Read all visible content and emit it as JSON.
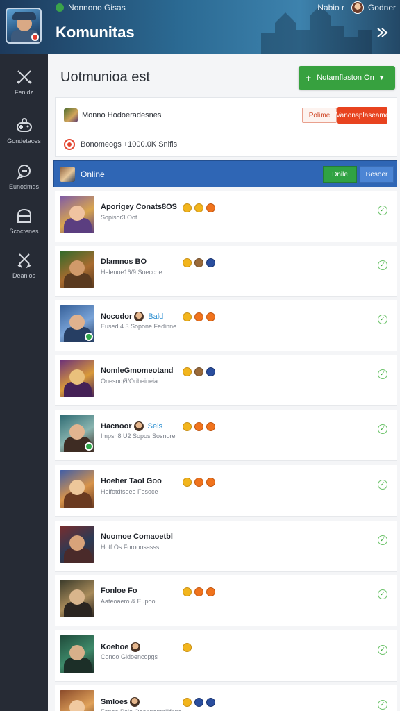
{
  "status_bar": {
    "app_name": "Nonnono Gisas",
    "right_text_1": "Nabio r",
    "right_text_2": "Godner"
  },
  "header": {
    "title": "Komunitas"
  },
  "sidebar": {
    "items": [
      {
        "label": "Fenidz",
        "icon": "swords-icon"
      },
      {
        "label": "Gondetaces",
        "icon": "controller-icon"
      },
      {
        "label": "Eunodmgs",
        "icon": "chat-icon"
      },
      {
        "label": "Scoctenes",
        "icon": "store-icon"
      },
      {
        "label": "Deanios",
        "icon": "crossed-swords-icon"
      }
    ]
  },
  "main": {
    "section_title": "Uotmunioa est",
    "add_button_label": "Notamflaston On",
    "info_card": {
      "row1_text": "Monno Hodoeradesnes",
      "button_outline": "Polime",
      "button_red": "Vanonsplaseame",
      "row2_text": "Bonomeogs +1000.0K Snifis"
    },
    "online_bar": {
      "label": "Online",
      "button_green": "Dnile",
      "button_blue": "Besoer"
    },
    "friends": [
      {
        "name": "Aporigey Conats8OS",
        "tag": "",
        "face": false,
        "sub": "Sopisor3 Oot",
        "medals": [
          "gold",
          "gold",
          "orange"
        ],
        "online_dot": false,
        "colors": [
          "#7d5aa8",
          "#d9a64f",
          "#f0c3a0",
          "#5b3e80"
        ]
      },
      {
        "name": "Dlamnos BO",
        "tag": "",
        "face": false,
        "sub": "Helenoe16/9 Soeccne",
        "medals": [
          "gold",
          "bronze",
          "blue"
        ],
        "online_dot": false,
        "colors": [
          "#2f6b2a",
          "#a86b2f",
          "#d19a6a",
          "#5a3a1f"
        ]
      },
      {
        "name": "Nocodor",
        "tag": "Bald",
        "face": true,
        "sub": "Eused 4.3 Sopone Fedinne",
        "medals": [
          "gold",
          "orange",
          "orange"
        ],
        "online_dot": true,
        "colors": [
          "#355f98",
          "#7aa4d8",
          "#e0b28e",
          "#263e63"
        ]
      },
      {
        "name": "NomleGmomeotand",
        "tag": "",
        "face": false,
        "sub": "OnesodØ/Oribeineia",
        "medals": [
          "gold",
          "bronze",
          "blue"
        ],
        "online_dot": false,
        "colors": [
          "#6a2f7a",
          "#d99a3a",
          "#e9c07c",
          "#452156"
        ]
      },
      {
        "name": "Hacnoor",
        "tag": "Seis",
        "face": true,
        "sub": "Impsn8 U2 Sopos Sosnore",
        "medals": [
          "gold",
          "orange",
          "orange"
        ],
        "online_dot": true,
        "colors": [
          "#2d6a72",
          "#8ab5b0",
          "#e2b48f",
          "#3e2c23"
        ]
      },
      {
        "name": "Hoeher Taol Goo",
        "tag": "",
        "face": false,
        "sub": "Holfotdfsoee Fesoce",
        "medals": [
          "gold",
          "orange",
          "orange"
        ],
        "online_dot": false,
        "colors": [
          "#3e5da8",
          "#d8944a",
          "#edc79a",
          "#6a3a20"
        ]
      },
      {
        "name": "Nuomoe Comaoetbl",
        "tag": "",
        "face": false,
        "sub": "Hoff Os Forooosasss",
        "medals": [],
        "online_dot": false,
        "colors": [
          "#7a2d2d",
          "#2b3a55",
          "#d8a37a",
          "#4a2a2a"
        ]
      },
      {
        "name": "Fonloe Fo",
        "tag": "",
        "face": false,
        "sub": "Aateoaero & Eupoo",
        "medals": [
          "gold",
          "orange",
          "orange"
        ],
        "online_dot": false,
        "colors": [
          "#3a3a2a",
          "#a88b5a",
          "#d9b58c",
          "#2b2520"
        ]
      },
      {
        "name": "Koehoe",
        "tag": "",
        "face": true,
        "sub": "Conoo Gidoencopgs",
        "medals": [
          "gold"
        ],
        "online_dot": false,
        "colors": [
          "#1f4a3a",
          "#3e8a6a",
          "#d8b08a",
          "#1c2f28"
        ]
      },
      {
        "name": "Smloes",
        "tag": "",
        "face": true,
        "sub": "Fenoe Polo Ooonnenmiiifnne",
        "medals": [
          "gold",
          "blue",
          "blue"
        ],
        "online_dot": false,
        "colors": [
          "#8a4a2a",
          "#e0a25a",
          "#f0c9a0",
          "#5a2f1a"
        ]
      }
    ]
  },
  "colors": {
    "accent_green": "#37a13f",
    "accent_red": "#e8431f",
    "online_blue": "#2f66b5",
    "sidebar_bg": "#262b35"
  }
}
